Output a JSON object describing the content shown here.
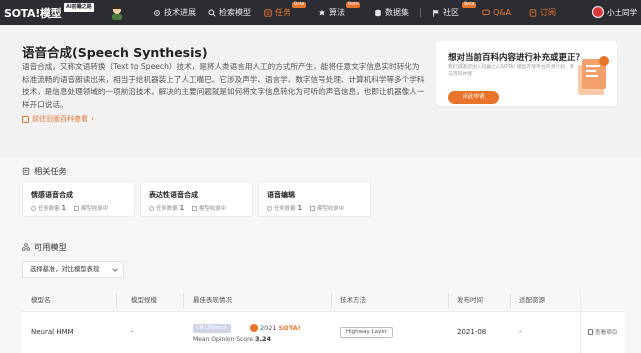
{
  "nav": {
    "logo": "SOTA!模型",
    "logo_sub": "AI前瞻之路",
    "items": [
      {
        "label": "技术进展",
        "icon": "gear-icon",
        "beta": ""
      },
      {
        "label": "检索模型",
        "icon": "search-icon",
        "beta": ""
      },
      {
        "label": "任务",
        "icon": "task-icon",
        "beta": "Beta"
      },
      {
        "label": "算法",
        "icon": "settings-icon",
        "beta": "Beta"
      },
      {
        "label": "数据集",
        "icon": "database-icon",
        "beta": ""
      },
      {
        "label": "社区",
        "icon": "flag-icon",
        "beta": "Beta"
      },
      {
        "label": "Q&A",
        "icon": "",
        "beta": ""
      },
      {
        "label": "订阅",
        "icon": "subscribe-icon",
        "beta": ""
      }
    ],
    "username": "小土同学"
  },
  "colors": {
    "accent": "#e9742c",
    "nav_bg": "#2b2d33"
  },
  "hero": {
    "title": "语音合成(Speech Synthesis)",
    "description": "语音合成，又称文语转换（Text to Speech）技术，是将人类语言用人工的方式所产生，能将任意文字信息实时转化为标准流畅的语音朗读出来，相当于给机器装上了人工嘴巴。它涉及声学、语言学、数字信号处理、计算机科学等多个学科技术，是信息处理领域的一项前沿技术，解决的主要问题就是如何将文字信息转化为可听的声音信息，也即让机器像人一样开口说话。",
    "wiki_link": "前往旧版百科查看"
  },
  "supplement": {
    "title": "想对当前百科内容进行补充或更正？",
    "text": "我们诚邀您加入机器之心SOTA! 模型开放平台内测计划，参与百科共建",
    "button": "点此申请"
  },
  "related": {
    "heading": "相关任务",
    "tasks": [
      {
        "name": "情感语音合成",
        "count_label": "任务数量",
        "count": "1",
        "status": "模型收录中"
      },
      {
        "name": "表达性语音合成",
        "count_label": "任务数量",
        "count": "1",
        "status": "模型收录中"
      },
      {
        "name": "语音编辑",
        "count_label": "任务数量",
        "count": "1",
        "status": "模型收录中"
      }
    ]
  },
  "models": {
    "heading": "可用模型",
    "select": "选择基准，对比模型表现",
    "columns": [
      "模型名",
      "模型规模",
      "最佳表现情况",
      "技术方法",
      "发布时间",
      "适配资源"
    ],
    "rows": [
      {
        "name": "Neural HMM",
        "scale": "-",
        "benchmark_tag": "CN LJSpeech",
        "sota_year": "2021",
        "sota_label": "SOTA!",
        "metric_name": "Mean Opinion Score",
        "metric_value": "3.24",
        "method": "Highway Layer",
        "date": "2021-08",
        "resources": "-",
        "action": "查看项目"
      }
    ]
  }
}
